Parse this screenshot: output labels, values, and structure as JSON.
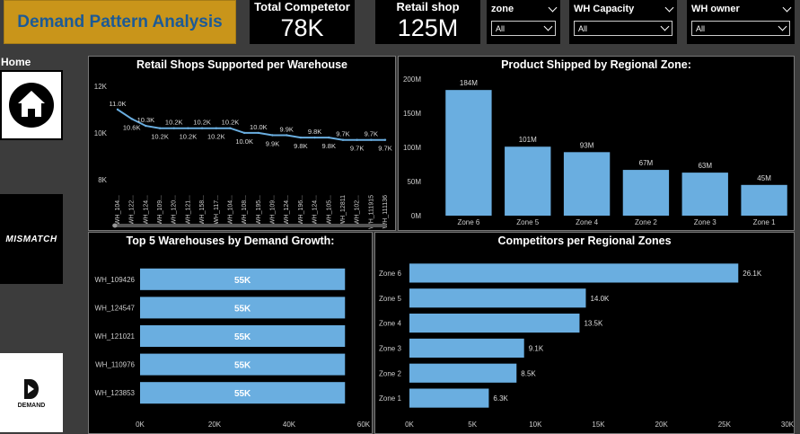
{
  "header": {
    "title": "Demand Pattern Analysis"
  },
  "kpis": [
    {
      "label": "Total Competetor",
      "value": "78K"
    },
    {
      "label": "Retail shop",
      "value": "125M"
    }
  ],
  "slicers": [
    {
      "label": "zone",
      "value": "All"
    },
    {
      "label": "WH Capacity",
      "value": "All"
    },
    {
      "label": "WH owner",
      "value": "All"
    }
  ],
  "nav": {
    "home_label": "Home",
    "mismatch_logo_text": "MISMATCH",
    "demand_logo_text": "DEMAND"
  },
  "colors": {
    "bar": "#6aaee0",
    "accent": "#c9951a",
    "title_text": "#1c5a96"
  },
  "chart_data": [
    {
      "type": "line",
      "title": "Retail Shops Supported per Warehouse",
      "x": [
        "WH_104...",
        "WH_122...",
        "WH_124...",
        "WH_109...",
        "WH_120...",
        "WH_121...",
        "WH_158...",
        "WH_117...",
        "WH_104...",
        "WH_108...",
        "WH_195...",
        "WH_109...",
        "WH_124...",
        "WH_196...",
        "WH_124...",
        "WH_105...",
        "WH_12811",
        "WH_102...",
        "WH_111915",
        "WH_111136"
      ],
      "values": [
        11000,
        10600,
        10300,
        10200,
        10200,
        10200,
        10200,
        10200,
        10200,
        10000,
        10000,
        9900,
        9900,
        9800,
        9800,
        9800,
        9700,
        9700,
        9700,
        9700
      ],
      "data_labels": [
        "11.0K",
        "10.6K",
        "10.3K",
        "10.2K",
        "10.2K",
        "10.2K",
        "10.2K",
        "10.2K",
        "10.2K",
        "10.0K",
        "10.0K",
        "9.9K",
        "9.9K",
        "9.8K",
        "9.8K",
        "9.8K",
        "9.7K",
        "9.7K",
        "9.7K",
        "9.7K"
      ],
      "yticks": [
        "12K",
        "10K",
        "8K"
      ],
      "ylim": [
        7500,
        12300
      ]
    },
    {
      "type": "bar",
      "title": "Product Shipped by Regional Zone:",
      "categories": [
        "Zone 6",
        "Zone 5",
        "Zone 4",
        "Zone 2",
        "Zone 3",
        "Zone 1"
      ],
      "values": [
        184,
        101,
        93,
        67,
        63,
        45
      ],
      "data_labels": [
        "184M",
        "101M",
        "93M",
        "67M",
        "63M",
        "45M"
      ],
      "yticks": [
        "200M",
        "150M",
        "100M",
        "50M",
        "0M"
      ],
      "ylim": [
        0,
        200
      ]
    },
    {
      "type": "bar",
      "orientation": "horizontal",
      "title": "Top 5 Warehouses by Demand Growth:",
      "categories": [
        "WH_109426",
        "WH_124547",
        "WH_121021",
        "WH_110976",
        "WH_123853"
      ],
      "values": [
        55,
        55,
        55,
        55,
        55
      ],
      "data_labels": [
        "55K",
        "55K",
        "55K",
        "55K",
        "55K"
      ],
      "xticks": [
        "0K",
        "20K",
        "40K",
        "60K"
      ],
      "xlim": [
        0,
        60
      ]
    },
    {
      "type": "bar",
      "orientation": "horizontal",
      "title": "Competitors per Regional Zones",
      "categories": [
        "Zone 6",
        "Zone 5",
        "Zone 4",
        "Zone 3",
        "Zone 2",
        "Zone 1"
      ],
      "values": [
        26.1,
        14.0,
        13.5,
        9.1,
        8.5,
        6.3
      ],
      "data_labels": [
        "26.1K",
        "14.0K",
        "13.5K",
        "9.1K",
        "8.5K",
        "6.3K"
      ],
      "xticks": [
        "0K",
        "5K",
        "10K",
        "15K",
        "20K",
        "25K",
        "30K"
      ],
      "xlim": [
        0,
        30
      ]
    }
  ]
}
